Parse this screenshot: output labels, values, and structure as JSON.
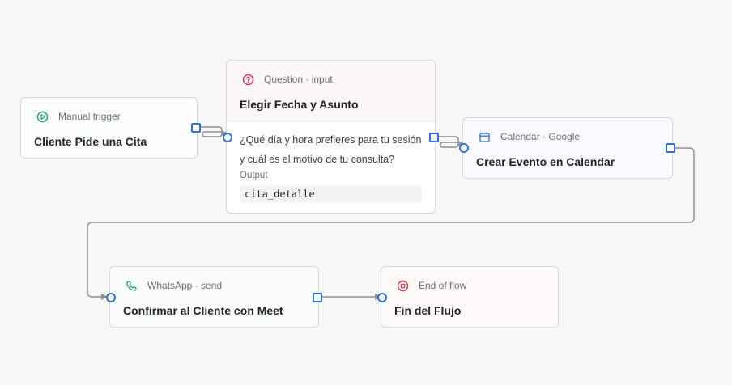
{
  "colors": {
    "edge": "#8c8f94",
    "port": "#2f6fde",
    "trigger_icon": "#1f9d6b",
    "question_icon": "#d6336c",
    "calendar_icon": "#2f6fde",
    "whatsapp_icon": "#1f9d6b",
    "end_icon": "#d9363e"
  },
  "nodes": {
    "trigger": {
      "icon": "play-circle-icon",
      "type": "Manual trigger",
      "title": "Cliente Pide una Cita"
    },
    "question": {
      "icon": "question-circle-icon",
      "type": "Question · input",
      "title": "Elegir Fecha y Asunto",
      "body": "¿Qué día y hora prefieres para tu sesión y cuál es el motivo de tu consulta?",
      "output_label": "Output",
      "output_var": "cita_detalle"
    },
    "calendar": {
      "icon": "calendar-icon",
      "type": "Calendar · Google",
      "title": "Crear Evento en Calendar"
    },
    "whatsapp": {
      "icon": "phone-icon",
      "type": "WhatsApp · send",
      "title": "Confirmar al Cliente con Meet"
    },
    "end": {
      "icon": "stop-circle-icon",
      "type": "End of flow",
      "title": "Fin del Flujo"
    }
  }
}
